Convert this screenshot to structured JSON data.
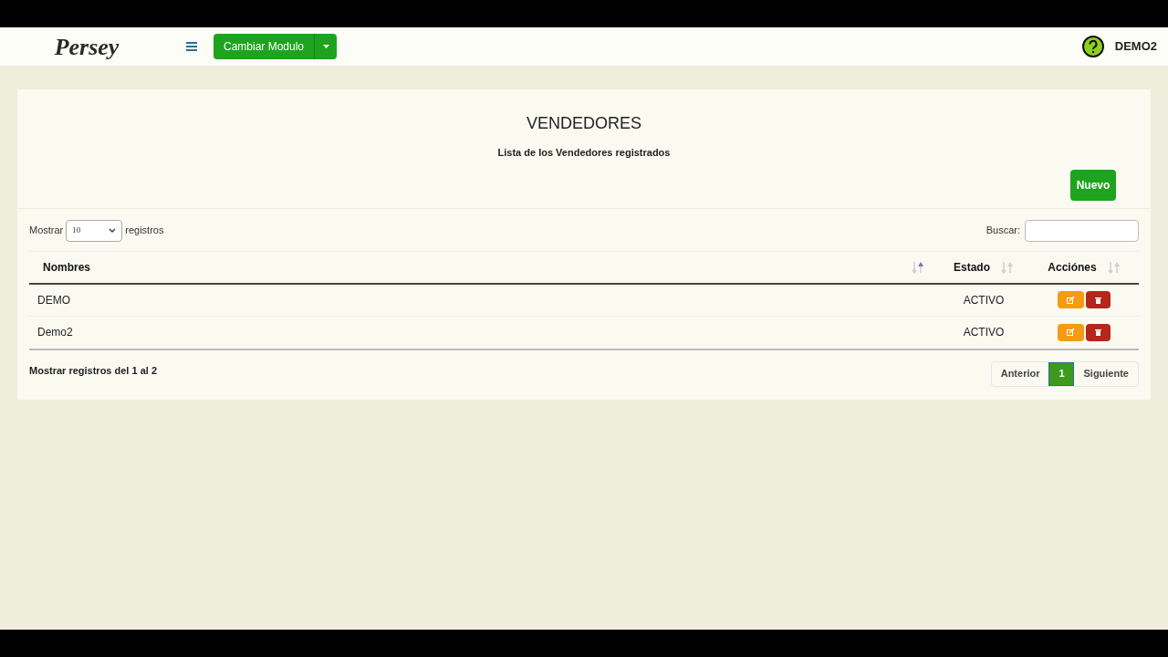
{
  "header": {
    "logo": "Persey",
    "module_button": "Cambiar Modulo",
    "user": "DEMO2"
  },
  "page": {
    "title": "VENDEDORES",
    "subtitle": "Lista de los Vendedores registrados",
    "new_button": "Nuevo"
  },
  "table_controls": {
    "show_label": "Mostrar",
    "page_size": "10",
    "records_label": "registros",
    "search_label": "Buscar:"
  },
  "table": {
    "columns": [
      {
        "label": "Nombres",
        "sorted": true
      },
      {
        "label": "Estado",
        "sorted": false
      },
      {
        "label": "Acciónes",
        "sorted": false
      }
    ],
    "rows": [
      {
        "name": "DEMO",
        "status": "ACTIVO"
      },
      {
        "name": "Demo2",
        "status": "ACTIVO"
      }
    ]
  },
  "footer": {
    "info": "Mostrar registros del 1 al 2",
    "prev": "Anterior",
    "next": "Siguiente",
    "pages": [
      {
        "label": "1",
        "selected": true
      }
    ]
  }
}
